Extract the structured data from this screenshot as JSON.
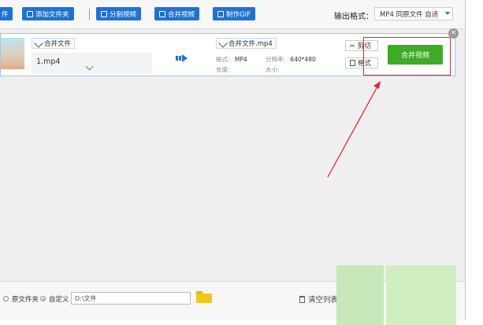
{
  "toolbar": {
    "partial_button": "件",
    "add_folder": "添加文件夹",
    "split_video": "分割视频",
    "merge_video": "合并视频",
    "make_gif": "制作GIF",
    "output_format_label": "输出格式：",
    "output_format_value": "MP4  同原文件 自适"
  },
  "file_row": {
    "merge_files_tag": "合并文件",
    "source_name": "1.mp4",
    "output_name": "合并文件.mp4",
    "format_key": "格式:",
    "format_val": "MP4",
    "resolution_key": "分辨率:",
    "resolution_val": "640*480",
    "duration_key": "长度:",
    "size_key": "大小:",
    "cut_button": "剪切",
    "style_button": "格式",
    "merge_button": "合并视频",
    "close_symbol": "×"
  },
  "bottom": {
    "radio_original": "原文件夹",
    "radio_custom": "自定义",
    "path_value": "D:\\文件",
    "clear_list": "清空列表"
  },
  "colors": {
    "accent_blue": "#1e73d2",
    "merge_green": "#3fab27",
    "highlight_red": "#e0282a"
  }
}
